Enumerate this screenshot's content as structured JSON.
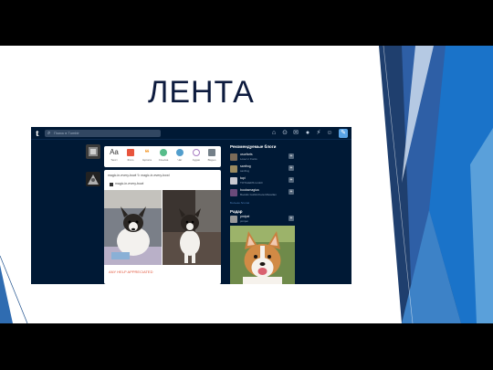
{
  "slide": {
    "title": "ЛЕНТА"
  },
  "colors": {
    "dashboard_bg": "#001935",
    "accent": "#5aa4e6",
    "title_color": "#0d1b3e",
    "caption_color": "#e2583e"
  },
  "topbar": {
    "logo": "t",
    "search_placeholder": "Поиск в Tumblr",
    "icons": [
      "home-icon",
      "explore-icon",
      "mail-icon",
      "chat-icon",
      "activity-icon",
      "account-icon",
      "compose-icon"
    ]
  },
  "post_types": [
    {
      "label": "Текст",
      "icon": "text-icon",
      "glyph": "Aa",
      "color": "#333333"
    },
    {
      "label": "Фото",
      "icon": "photo-icon",
      "glyph": "",
      "color": "#e8553d"
    },
    {
      "label": "Цитата",
      "icon": "quote-icon",
      "glyph": "❝",
      "color": "#f2992e"
    },
    {
      "label": "Ссылка",
      "icon": "link-icon",
      "glyph": "",
      "color": "#56bc8a"
    },
    {
      "label": "Чат",
      "icon": "chat-post-icon",
      "glyph": "",
      "color": "#529ecc"
    },
    {
      "label": "Аудио",
      "icon": "audio-icon",
      "glyph": "",
      "color": "#a77dc2"
    },
    {
      "label": "Видео",
      "icon": "video-icon",
      "glyph": "",
      "color": "#748089"
    }
  ],
  "post": {
    "header": "magic-in-every-bowl ↻ magic-in-every-bowl",
    "reblog_name": "magic-in-every-bowl",
    "caption": "ANY HELP APPRECIATED"
  },
  "sidebar": {
    "recommended_title": "Рекомендуемые блоги",
    "blogs": [
      {
        "name": "usurfarts",
        "sub": "Lose U. Fonts",
        "color": "#7a6a58"
      },
      {
        "name": "sanfrog",
        "sub": "sanfrog",
        "color": "#9a8a60"
      },
      {
        "name": "tupi",
        "sub": "TOTALEDS tumblr",
        "color": "#c8c8d0"
      },
      {
        "name": "booksmagica",
        "sub": "Booklin Goblin/Ceta Miscellan",
        "color": "#6a4a7a"
      }
    ],
    "more_blogs": "Больше блогов",
    "radar_title": "Радар",
    "radar_blog": {
      "name": "pmipei",
      "sub": "pmipei"
    }
  }
}
